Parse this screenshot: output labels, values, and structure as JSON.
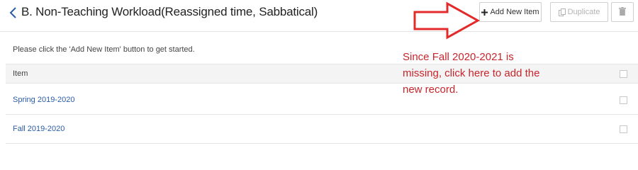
{
  "header": {
    "title": "B. Non-Teaching Workload(Reassigned time, Sabbatical)",
    "back_icon": "chevron-left-icon"
  },
  "toolbar": {
    "add_label": "Add New Item",
    "duplicate_label": "Duplicate",
    "add_icon": "plus-icon",
    "duplicate_icon": "copy-icon",
    "delete_icon": "trash-icon"
  },
  "intro_text": "Please click the 'Add New Item' button to get started.",
  "table": {
    "column_header": "Item",
    "rows": [
      {
        "label": "Spring 2019-2020"
      },
      {
        "label": "Fall 2019-2020"
      }
    ]
  },
  "annotation": {
    "text": "Since Fall 2020-2021 is missing, click here to add the new record.",
    "color": "#c8252c",
    "arrow_icon": "red-arrow-icon"
  },
  "colors": {
    "link": "#2a5cab",
    "annotation": "#c8252c",
    "header_bg": "#f4f4f4"
  }
}
